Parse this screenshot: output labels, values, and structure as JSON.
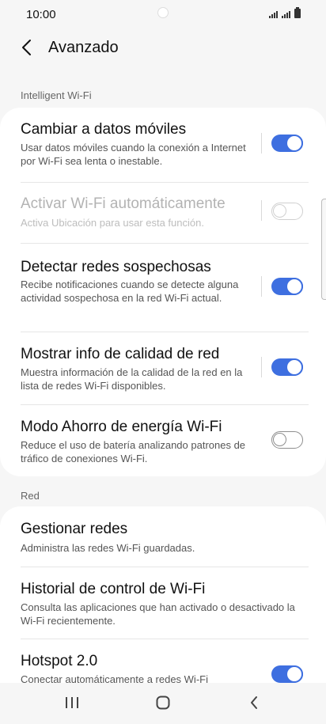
{
  "status_bar": {
    "time": "10:00"
  },
  "header": {
    "title": "Avanzado"
  },
  "sections": [
    {
      "header": "Intelligent Wi-Fi",
      "items": [
        {
          "title": "Cambiar a datos móviles",
          "subtitle": "Usar datos móviles cuando la conexión a Internet por Wi-Fi sea lenta o inestable.",
          "toggle": "on",
          "enabled": true
        },
        {
          "title": "Activar Wi-Fi automáticamente",
          "subtitle": "Activa Ubicación para usar esta función.",
          "toggle": "off",
          "enabled": false
        },
        {
          "title": "Detectar redes sospechosas",
          "subtitle": "Recibe notificaciones cuando se detecte alguna actividad sospechosa en la red Wi-Fi actual.",
          "toggle": "on",
          "enabled": true
        },
        {
          "title": "Mostrar info de calidad de red",
          "subtitle": "Muestra información de la calidad de la red en la lista de redes Wi-Fi disponibles.",
          "toggle": "on",
          "enabled": true
        },
        {
          "title": "Modo Ahorro de energía Wi-Fi",
          "subtitle": "Reduce el uso de batería analizando patrones de tráfico de conexiones Wi-Fi.",
          "toggle": "off",
          "enabled": true
        }
      ]
    },
    {
      "header": "Red",
      "items": [
        {
          "title": "Gestionar redes",
          "subtitle": "Administra las redes Wi-Fi guardadas."
        },
        {
          "title": "Historial de control de Wi-Fi",
          "subtitle": "Consulta las aplicaciones que han activado o desactivado la Wi-Fi recientemente."
        },
        {
          "title": "Hotspot 2.0",
          "subtitle": "Conectar automáticamente a redes Wi-Fi",
          "toggle": "on",
          "enabled": true
        }
      ]
    }
  ],
  "colors": {
    "accent": "#3e6fe0",
    "background": "#f6f6f6",
    "card": "#ffffff"
  },
  "icons": {
    "back": "chevron-left-icon",
    "recents": "recents-icon",
    "home": "home-icon",
    "nav_back": "nav-back-icon"
  }
}
